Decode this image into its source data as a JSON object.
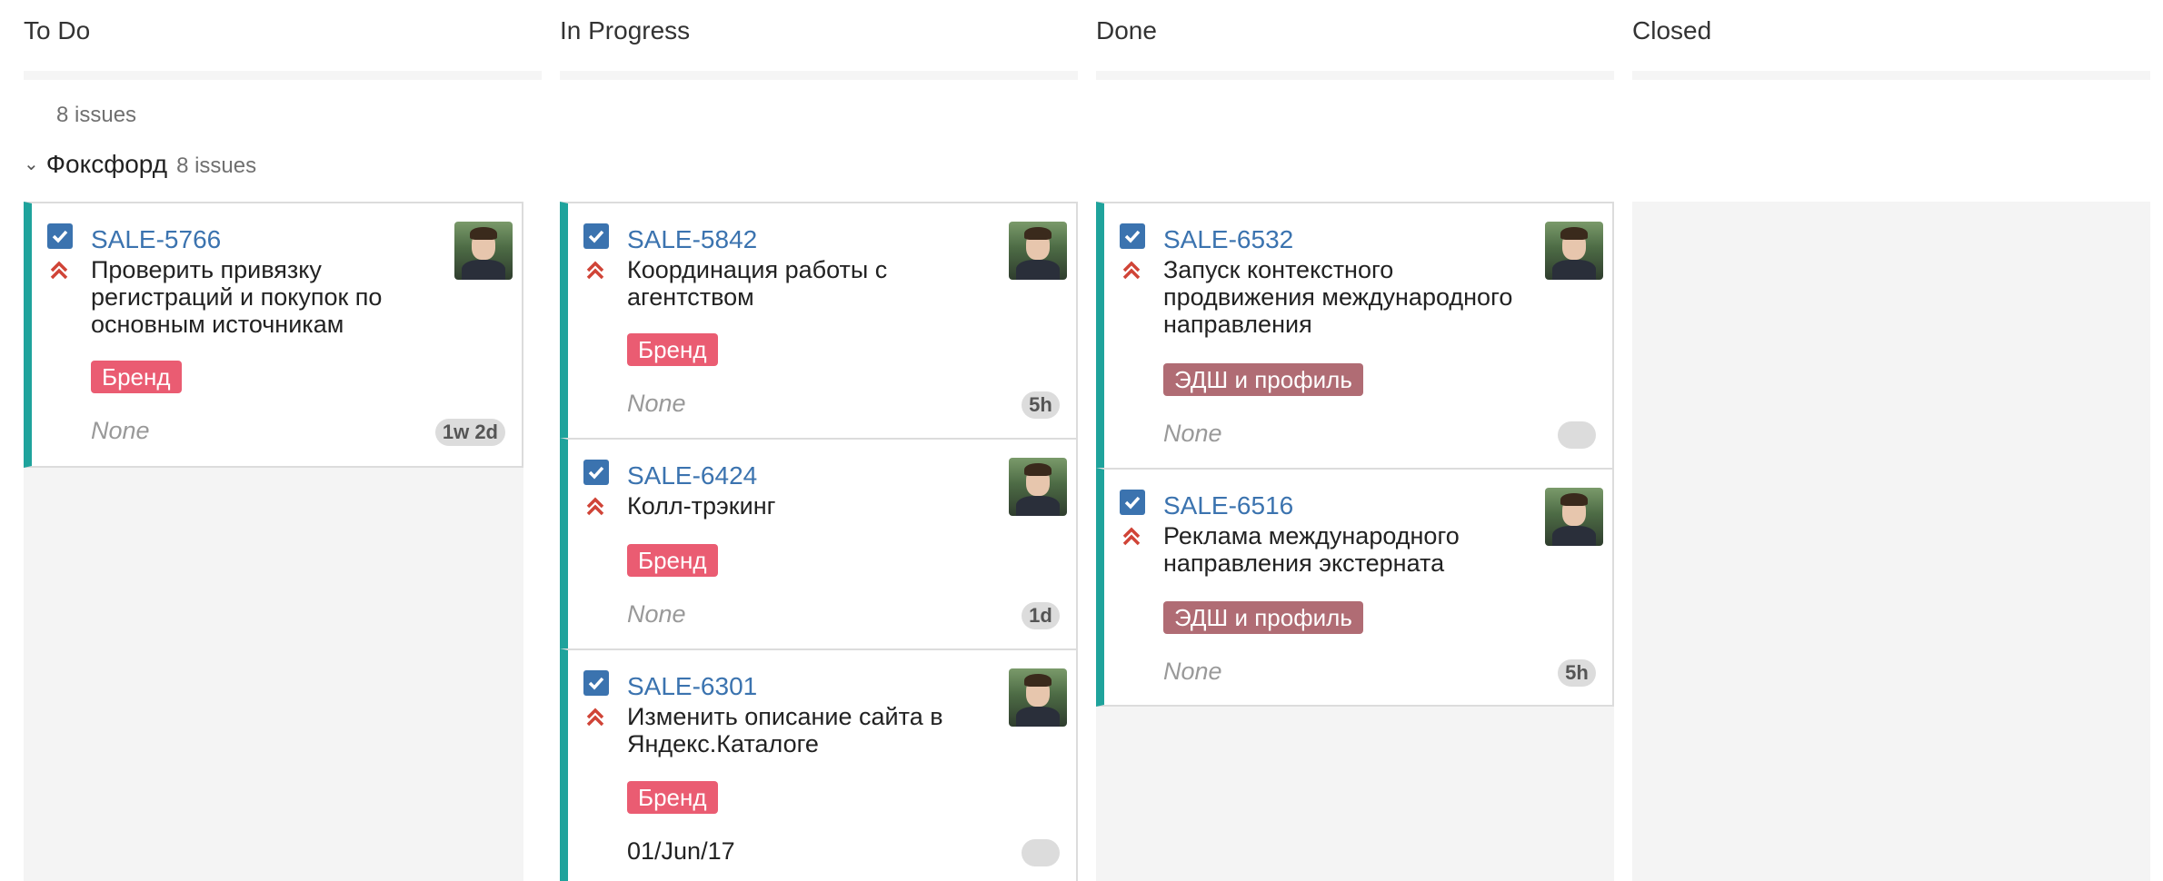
{
  "columns": [
    {
      "title": "To Do"
    },
    {
      "title": "In Progress"
    },
    {
      "title": "Done"
    },
    {
      "title": "Closed"
    }
  ],
  "summary": "8 issues",
  "swimlane": {
    "name": "Фоксфорд",
    "count": "8 issues"
  },
  "colors": {
    "accent": "#3b73af",
    "flag": "#1fa39c",
    "brand_label": "#ea5c72",
    "edsh_label": "#b06c74",
    "priority": "#d04437"
  },
  "cards": {
    "todo": [
      {
        "key": "SALE-5766",
        "summary": "Проверить привязку регистраций и покупок по основным источникам",
        "label": "Бренд",
        "fix_version": "None",
        "estimate": "1w 2d",
        "icon": "checkbox-icon",
        "priority_icon": "highest-priority-icon"
      }
    ],
    "in_progress": [
      {
        "key": "SALE-5842",
        "summary": "Координация работы с агентством",
        "label": "Бренд",
        "fix_version": "None",
        "estimate": "5h"
      },
      {
        "key": "SALE-6424",
        "summary": "Колл-трэкинг",
        "label": "Бренд",
        "fix_version": "None",
        "estimate": "1d"
      },
      {
        "key": "SALE-6301",
        "summary": "Изменить описание сайта в Яндекс.Каталоге",
        "label": "Бренд",
        "fix_version": "01/Jun/17",
        "estimate": ""
      }
    ],
    "done": [
      {
        "key": "SALE-6532",
        "summary": "Запуск контекстного продвижения международного направления",
        "label": "ЭДШ и профиль",
        "fix_version": "None",
        "estimate": ""
      },
      {
        "key": "SALE-6516",
        "summary": "Реклама международного направления экстерната",
        "label": "ЭДШ и профиль",
        "fix_version": "None",
        "estimate": "5h"
      }
    ]
  }
}
